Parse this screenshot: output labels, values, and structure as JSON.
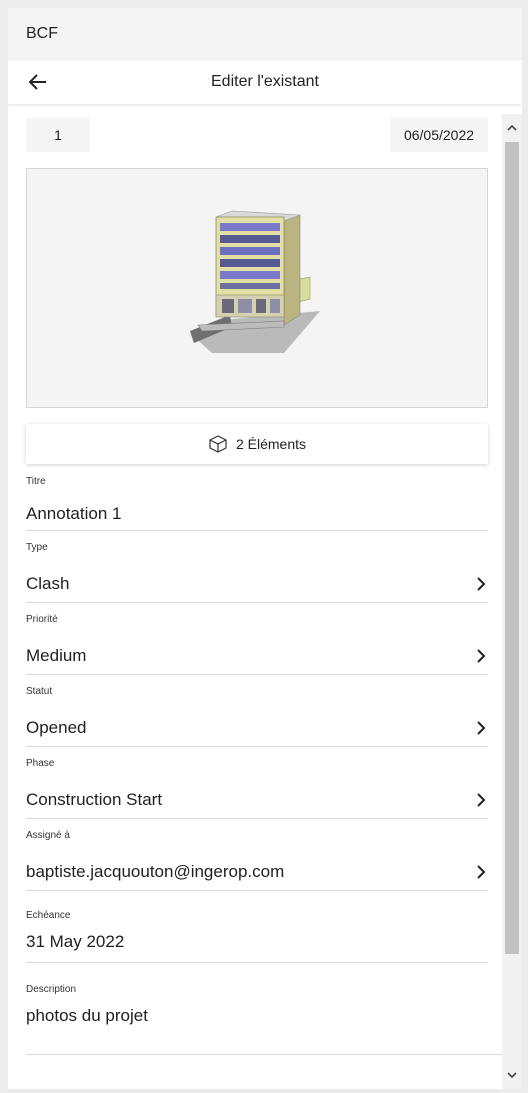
{
  "app": {
    "title": "BCF"
  },
  "nav": {
    "title": "Editer l'existant",
    "back_icon": "arrow-left-icon"
  },
  "topic": {
    "number": "1",
    "date": "06/05/2022"
  },
  "elements_button": {
    "label": "2 Éléments",
    "icon": "cube-icon"
  },
  "fields": {
    "title": {
      "label": "Titre",
      "value": "Annotation 1"
    },
    "type": {
      "label": "Type",
      "value": "Clash"
    },
    "priority": {
      "label": "Priorité",
      "value": "Medium"
    },
    "status": {
      "label": "Statut",
      "value": "Opened"
    },
    "phase": {
      "label": "Phase",
      "value": "Construction Start"
    },
    "assigned": {
      "label": "Assigné à",
      "value": "baptiste.jacquouton@ingerop.com"
    },
    "due": {
      "label": "Echéance",
      "value": "31 May 2022"
    },
    "description": {
      "label": "Description",
      "value": "photos du projet"
    }
  }
}
